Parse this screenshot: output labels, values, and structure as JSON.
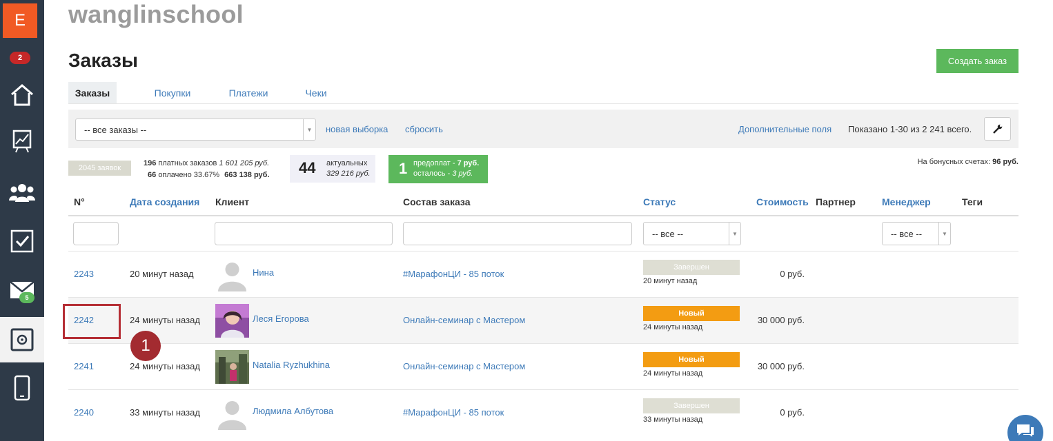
{
  "sidebar": {
    "logo": "E",
    "notification_count": "2",
    "mail_badge": "5",
    "items": [
      {
        "icon": "home-icon"
      },
      {
        "icon": "chart-icon"
      },
      {
        "icon": "users-icon"
      },
      {
        "icon": "tasks-icon"
      },
      {
        "icon": "mail-icon"
      },
      {
        "icon": "sales-icon",
        "active": true
      },
      {
        "icon": "mobile-icon"
      }
    ]
  },
  "school_name": "wanglinschool",
  "page_title": "Заказы",
  "create_button": "Создать заказ",
  "tabs": [
    "Заказы",
    "Покупки",
    "Платежи",
    "Чеки"
  ],
  "filter": {
    "selection": "-- все заказы --",
    "new_selection": "новая выборка",
    "reset": "сбросить",
    "extra_fields": "Дополнительные поля",
    "shown": "Показано 1-30 из 2 241 всего."
  },
  "stats": {
    "total": "2045 заявок",
    "paid_line1_count": "196",
    "paid_line1_text": "платных заказов",
    "paid_line1_sum": "1 601 205 руб.",
    "paid_line2_count": "66",
    "paid_line2_text": "оплачено 33.67%",
    "paid_line2_sum": "663 138 руб.",
    "actual_count": "44",
    "actual_label": "актуальных",
    "actual_sum": "329 216 руб.",
    "prepay_count": "1",
    "prepay_label": "предоплат -",
    "prepay_sum": "7 руб.",
    "prepay_left": "осталось -",
    "prepay_left_sum": "3 руб.",
    "bonus_label": "На бонусных счетах:",
    "bonus_value": "96 руб."
  },
  "table": {
    "headers": {
      "num": "N°",
      "date": "Дата создания",
      "client": "Клиент",
      "order": "Состав заказа",
      "status": "Статус",
      "cost": "Стоимость",
      "partner": "Партнер",
      "manager": "Менеджер",
      "tags": "Теги"
    },
    "status_filter": "-- все --",
    "manager_filter": "-- все --",
    "rows": [
      {
        "num": "2243",
        "date": "20 минут назад",
        "client": "Нина",
        "order": "#МарафонЦИ - 85 поток",
        "status": "Завершен",
        "status_time": "20 минут назад",
        "cost": "0 руб."
      },
      {
        "num": "2242",
        "date": "24 минуты назад",
        "client": "Леся Егорова",
        "order": "Онлайн-семинар с Мастером",
        "status": "Новый",
        "status_time": "24 минуты назад",
        "cost": "30 000 руб."
      },
      {
        "num": "2241",
        "date": "24 минуты назад",
        "client": "Natalia Ryzhukhina",
        "order": "Онлайн-семинар с Мастером",
        "status": "Новый",
        "status_time": "24 минуты назад",
        "cost": "30 000 руб."
      },
      {
        "num": "2240",
        "date": "33 минуты назад",
        "client": "Людмила Албутова",
        "order": "#МарафонЦИ - 85 поток",
        "status": "Завершен",
        "status_time": "33 минуты назад",
        "cost": "0 руб."
      }
    ]
  },
  "callout_number": "1",
  "colors": {
    "sidebar": "#2e3a48",
    "logo": "#f15a24",
    "link": "#3d7ab8",
    "green": "#5cb85c",
    "orange": "#f39c12",
    "annotation": "#a32b30"
  }
}
